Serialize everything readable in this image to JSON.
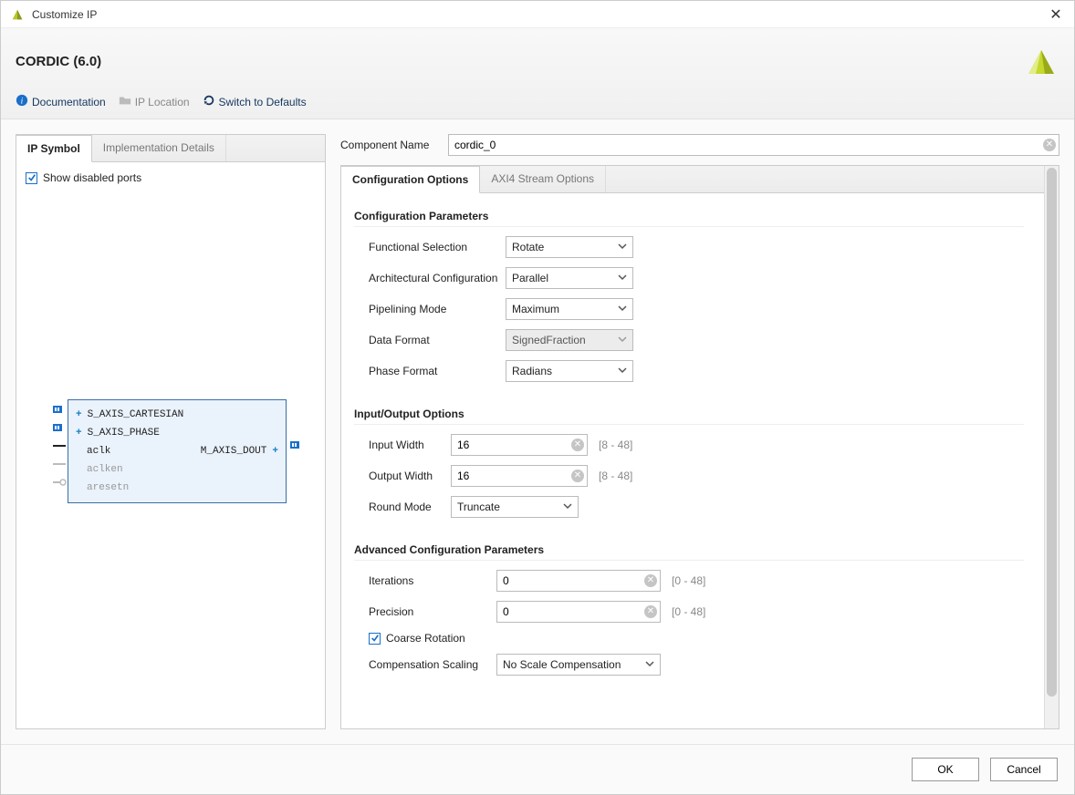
{
  "window": {
    "title": "Customize IP"
  },
  "header": {
    "title": "CORDIC (6.0)"
  },
  "toolbar": {
    "documentation": "Documentation",
    "ip_location": "IP Location",
    "switch_defaults": "Switch to Defaults"
  },
  "left": {
    "tabs": {
      "ip_symbol": "IP Symbol",
      "impl_details": "Implementation Details"
    },
    "show_disabled_label": "Show disabled ports",
    "show_disabled_checked": true,
    "ports": {
      "s_cartesian": "S_AXIS_CARTESIAN",
      "s_phase": "S_AXIS_PHASE",
      "aclk": "aclk",
      "aclken": "aclken",
      "aresetn": "aresetn",
      "m_dout": "M_AXIS_DOUT"
    }
  },
  "component": {
    "label": "Component Name",
    "value": "cordic_0"
  },
  "config_tabs": {
    "config_options": "Configuration Options",
    "axi4": "AXI4 Stream Options"
  },
  "sections": {
    "config_params": "Configuration Parameters",
    "io_options": "Input/Output Options",
    "advanced": "Advanced Configuration Parameters"
  },
  "params": {
    "functional_selection": {
      "label": "Functional Selection",
      "value": "Rotate"
    },
    "arch_config": {
      "label": "Architectural Configuration",
      "value": "Parallel"
    },
    "pipelining_mode": {
      "label": "Pipelining Mode",
      "value": "Maximum"
    },
    "data_format": {
      "label": "Data Format",
      "value": "SignedFraction",
      "disabled": true
    },
    "phase_format": {
      "label": "Phase Format",
      "value": "Radians"
    }
  },
  "io": {
    "input_width": {
      "label": "Input Width",
      "value": "16",
      "range": "[8 - 48]"
    },
    "output_width": {
      "label": "Output Width",
      "value": "16",
      "range": "[8 - 48]"
    },
    "round_mode": {
      "label": "Round Mode",
      "value": "Truncate"
    }
  },
  "advanced": {
    "iterations": {
      "label": "Iterations",
      "value": "0",
      "range": "[0 - 48]"
    },
    "precision": {
      "label": "Precision",
      "value": "0",
      "range": "[0 - 48]"
    },
    "coarse_rotation": {
      "label": "Coarse Rotation",
      "checked": true
    },
    "comp_scaling": {
      "label": "Compensation Scaling",
      "value": "No Scale Compensation"
    }
  },
  "footer": {
    "ok": "OK",
    "cancel": "Cancel"
  }
}
